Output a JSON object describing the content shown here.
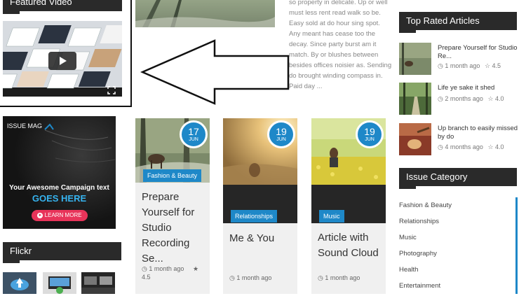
{
  "featured_video": {
    "title": "Featured Video"
  },
  "article_excerpt": {
    "lines": [
      "so property in delicate. Up or well",
      "must less rent read walk so be.",
      "Easy sold at do hour sing spot.",
      "Any meant has cease too the",
      "decay. Since party burst am it",
      "match. By or blushes between",
      "besides offices noisier as. Sending",
      "do brought winding compass in.",
      "Paid day ..."
    ]
  },
  "ad": {
    "brand": "ISSUE MAG",
    "line1": "Your Awesome Campaign text",
    "line2": "GOES HERE",
    "button": "LEARN MORE"
  },
  "flickr": {
    "title": "Flickr"
  },
  "cards": [
    {
      "day": "17",
      "month": "JUN",
      "category": "Fashion & Beauty",
      "title": "Prepare Yourself for Studio Recording Se...",
      "date": "1 month ago",
      "rating": "4.5"
    },
    {
      "day": "19",
      "month": "JUN",
      "category": "Relationships",
      "title": "Me & You",
      "date": "1 month ago"
    },
    {
      "day": "19",
      "month": "JUN",
      "category": "Music",
      "title": "Article with Sound Cloud",
      "date": "1 month ago"
    }
  ],
  "top_rated": {
    "title": "Top Rated Articles",
    "items": [
      {
        "title": "Prepare Yourself for Studio Re...",
        "date": "1 month ago",
        "rating": "4.5"
      },
      {
        "title": "Life ye sake it shed",
        "date": "2 months ago",
        "rating": "4.0"
      },
      {
        "title": "Up branch to easily missed by do",
        "date": "4 months ago",
        "rating": "4.0"
      }
    ]
  },
  "issue_category": {
    "title": "Issue Category",
    "items": [
      "Fashion & Beauty",
      "Relationships",
      "Music",
      "Photography",
      "Health",
      "Entertainment"
    ]
  },
  "colors": {
    "accent": "#1e88c8",
    "dark": "#2a2a2a"
  }
}
